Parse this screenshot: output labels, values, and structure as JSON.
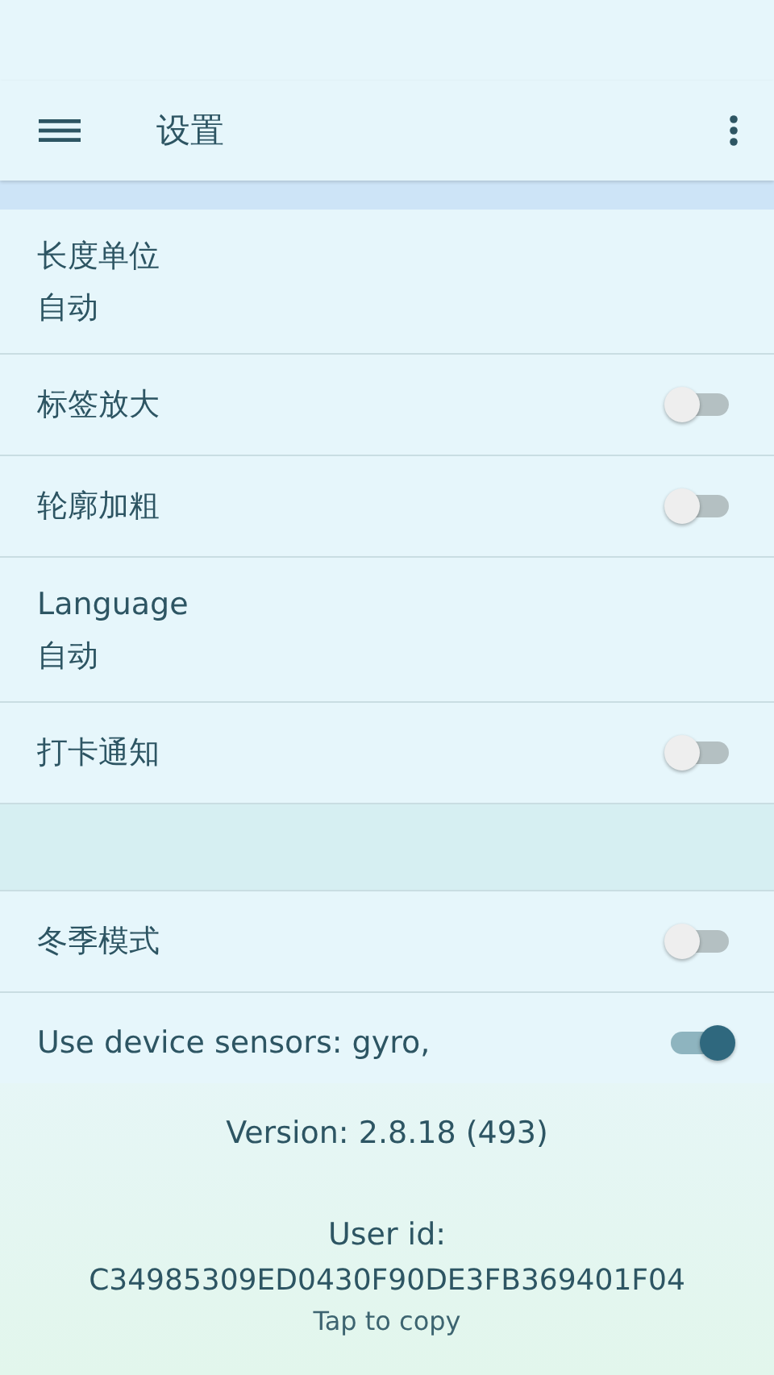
{
  "toolbar": {
    "title": "设置"
  },
  "settings": [
    {
      "kind": "value",
      "title": "长度单位",
      "value": "自动"
    },
    {
      "kind": "toggle",
      "title": "标签放大",
      "on": false
    },
    {
      "kind": "toggle",
      "title": "轮廓加粗",
      "on": false
    },
    {
      "kind": "value",
      "title": "Language",
      "value": "自动"
    },
    {
      "kind": "toggle",
      "title": "打卡通知",
      "on": false
    },
    {
      "kind": "gap"
    },
    {
      "kind": "toggle",
      "title": "冬季模式",
      "on": false
    },
    {
      "kind": "toggle",
      "title": "Use device sensors: gyro,",
      "on": true
    }
  ],
  "footer": {
    "version": "Version: 2.8.18 (493)",
    "user_id_label": "User id:",
    "user_id": "C34985309ED0430F90DE3FB369401F04",
    "hint": "Tap to copy"
  }
}
